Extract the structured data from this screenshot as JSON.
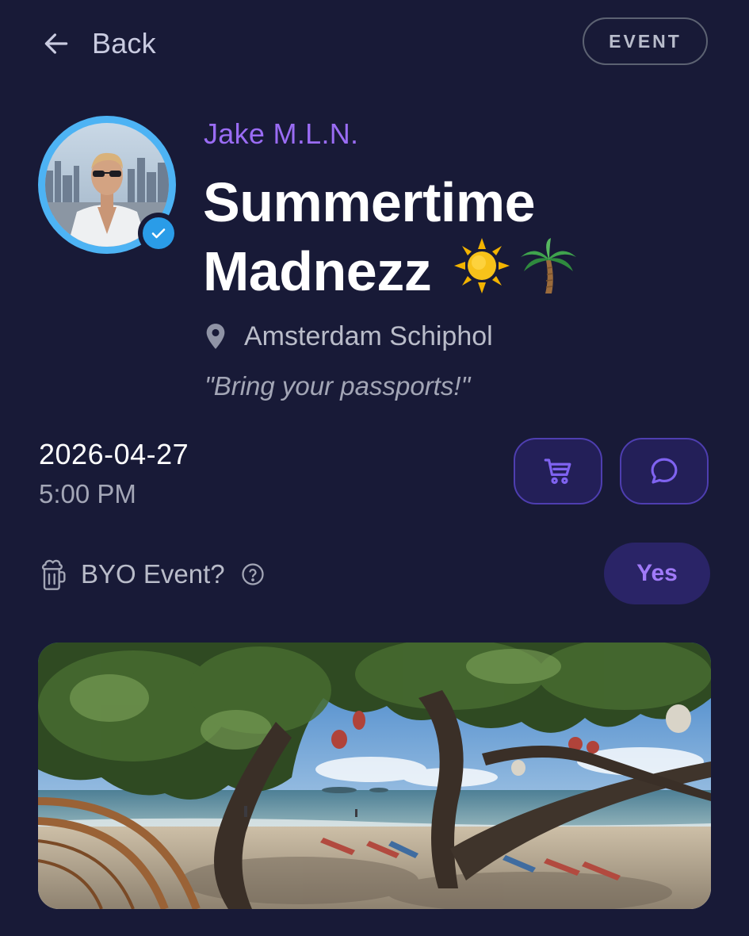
{
  "header": {
    "back_label": "Back",
    "badge_label": "EVENT"
  },
  "host": {
    "name": "Jake M.L.N.",
    "verified": true
  },
  "event": {
    "title_line1": "Summertime",
    "title_line2": "Madnezz",
    "title_emoji": [
      "sun",
      "palm-tree"
    ],
    "location": "Amsterdam Schiphol",
    "tagline": "\"Bring your passports!\"",
    "date": "2026-04-27",
    "time": "5:00 PM"
  },
  "actions": {
    "cart_icon": "shopping-cart-icon",
    "chat_icon": "chat-bubble-icon"
  },
  "byo": {
    "label": "BYO Event?",
    "value": "Yes"
  },
  "colors": {
    "background": "#181a37",
    "accent_purple": "#9a6cf4",
    "avatar_ring": "#4db3f4",
    "button_bg": "#231f58"
  }
}
